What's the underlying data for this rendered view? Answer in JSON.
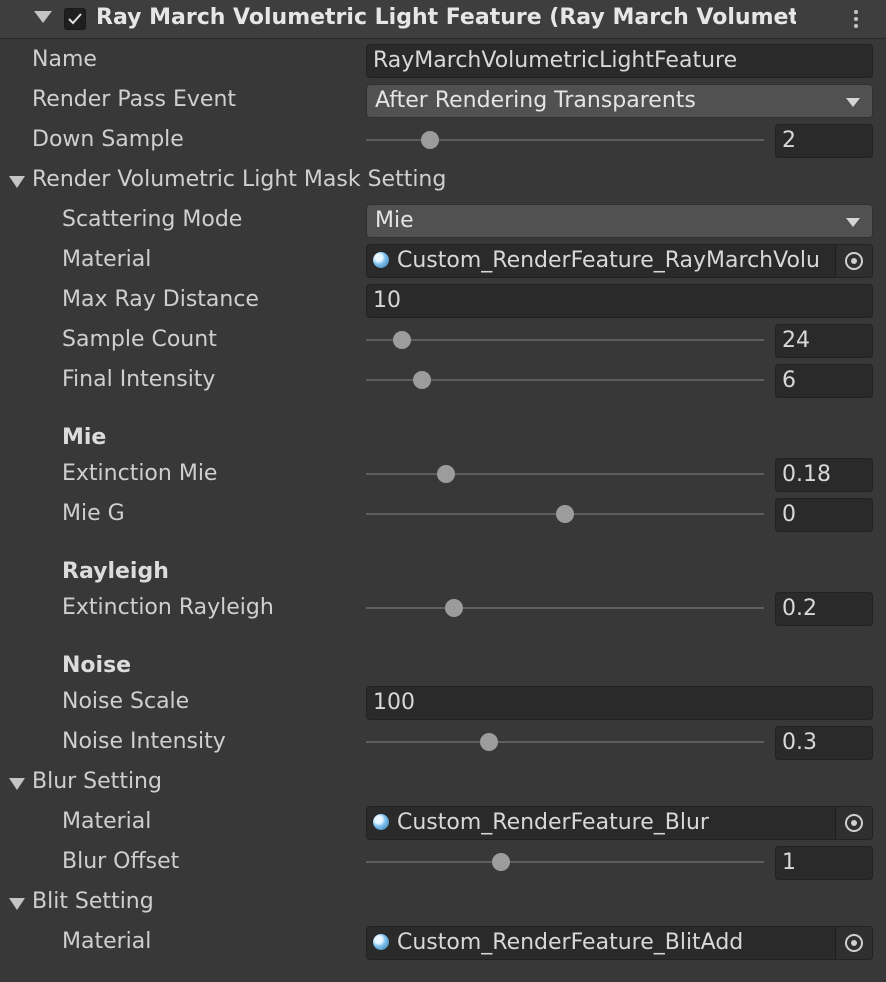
{
  "header": {
    "title": "Ray March Volumetric Light Feature (Ray March Volumetric",
    "enabled": true
  },
  "fields": {
    "name": {
      "label": "Name",
      "value": "RayMarchVolumetricLightFeature"
    },
    "render_pass_event": {
      "label": "Render Pass Event",
      "value": "After Rendering Transparents"
    },
    "down_sample": {
      "label": "Down Sample",
      "value": "2",
      "slider_fraction": 0.16
    }
  },
  "mask_section": {
    "label": "Render Volumetric Light Mask Setting",
    "scattering_mode": {
      "label": "Scattering Mode",
      "value": "Mie"
    },
    "material": {
      "label": "Material",
      "value": "Custom_RenderFeature_RayMarchVolu"
    },
    "max_ray_distance": {
      "label": "Max Ray Distance",
      "value": "10"
    },
    "sample_count": {
      "label": "Sample Count",
      "value": "24",
      "slider_fraction": 0.09
    },
    "final_intensity": {
      "label": "Final Intensity",
      "value": "6",
      "slider_fraction": 0.14
    },
    "mie_header": "Mie",
    "extinction_mie": {
      "label": "Extinction Mie",
      "value": "0.18",
      "slider_fraction": 0.2
    },
    "mie_g": {
      "label": "Mie G",
      "value": "0",
      "slider_fraction": 0.5
    },
    "rayleigh_header": "Rayleigh",
    "extinction_rayleigh": {
      "label": "Extinction Rayleigh",
      "value": "0.2",
      "slider_fraction": 0.22
    },
    "noise_header": "Noise",
    "noise_scale": {
      "label": "Noise Scale",
      "value": "100"
    },
    "noise_intensity": {
      "label": "Noise Intensity",
      "value": "0.3",
      "slider_fraction": 0.31
    }
  },
  "blur_section": {
    "label": "Blur Setting",
    "material": {
      "label": "Material",
      "value": "Custom_RenderFeature_Blur"
    },
    "blur_offset": {
      "label": "Blur Offset",
      "value": "1",
      "slider_fraction": 0.34
    }
  },
  "blit_section": {
    "label": "Blit Setting",
    "material": {
      "label": "Material",
      "value": "Custom_RenderFeature_BlitAdd"
    }
  }
}
